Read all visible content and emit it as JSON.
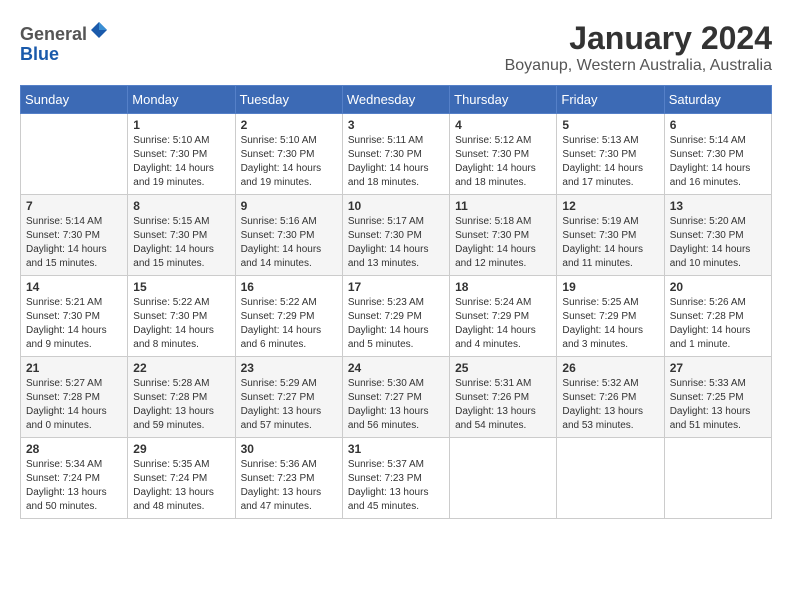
{
  "header": {
    "logo_line1": "General",
    "logo_line2": "Blue",
    "month_year": "January 2024",
    "location": "Boyanup, Western Australia, Australia"
  },
  "weekdays": [
    "Sunday",
    "Monday",
    "Tuesday",
    "Wednesday",
    "Thursday",
    "Friday",
    "Saturday"
  ],
  "weeks": [
    [
      {
        "num": "",
        "info": ""
      },
      {
        "num": "1",
        "info": "Sunrise: 5:10 AM\nSunset: 7:30 PM\nDaylight: 14 hours\nand 19 minutes."
      },
      {
        "num": "2",
        "info": "Sunrise: 5:10 AM\nSunset: 7:30 PM\nDaylight: 14 hours\nand 19 minutes."
      },
      {
        "num": "3",
        "info": "Sunrise: 5:11 AM\nSunset: 7:30 PM\nDaylight: 14 hours\nand 18 minutes."
      },
      {
        "num": "4",
        "info": "Sunrise: 5:12 AM\nSunset: 7:30 PM\nDaylight: 14 hours\nand 18 minutes."
      },
      {
        "num": "5",
        "info": "Sunrise: 5:13 AM\nSunset: 7:30 PM\nDaylight: 14 hours\nand 17 minutes."
      },
      {
        "num": "6",
        "info": "Sunrise: 5:14 AM\nSunset: 7:30 PM\nDaylight: 14 hours\nand 16 minutes."
      }
    ],
    [
      {
        "num": "7",
        "info": "Sunrise: 5:14 AM\nSunset: 7:30 PM\nDaylight: 14 hours\nand 15 minutes."
      },
      {
        "num": "8",
        "info": "Sunrise: 5:15 AM\nSunset: 7:30 PM\nDaylight: 14 hours\nand 15 minutes."
      },
      {
        "num": "9",
        "info": "Sunrise: 5:16 AM\nSunset: 7:30 PM\nDaylight: 14 hours\nand 14 minutes."
      },
      {
        "num": "10",
        "info": "Sunrise: 5:17 AM\nSunset: 7:30 PM\nDaylight: 14 hours\nand 13 minutes."
      },
      {
        "num": "11",
        "info": "Sunrise: 5:18 AM\nSunset: 7:30 PM\nDaylight: 14 hours\nand 12 minutes."
      },
      {
        "num": "12",
        "info": "Sunrise: 5:19 AM\nSunset: 7:30 PM\nDaylight: 14 hours\nand 11 minutes."
      },
      {
        "num": "13",
        "info": "Sunrise: 5:20 AM\nSunset: 7:30 PM\nDaylight: 14 hours\nand 10 minutes."
      }
    ],
    [
      {
        "num": "14",
        "info": "Sunrise: 5:21 AM\nSunset: 7:30 PM\nDaylight: 14 hours\nand 9 minutes."
      },
      {
        "num": "15",
        "info": "Sunrise: 5:22 AM\nSunset: 7:30 PM\nDaylight: 14 hours\nand 8 minutes."
      },
      {
        "num": "16",
        "info": "Sunrise: 5:22 AM\nSunset: 7:29 PM\nDaylight: 14 hours\nand 6 minutes."
      },
      {
        "num": "17",
        "info": "Sunrise: 5:23 AM\nSunset: 7:29 PM\nDaylight: 14 hours\nand 5 minutes."
      },
      {
        "num": "18",
        "info": "Sunrise: 5:24 AM\nSunset: 7:29 PM\nDaylight: 14 hours\nand 4 minutes."
      },
      {
        "num": "19",
        "info": "Sunrise: 5:25 AM\nSunset: 7:29 PM\nDaylight: 14 hours\nand 3 minutes."
      },
      {
        "num": "20",
        "info": "Sunrise: 5:26 AM\nSunset: 7:28 PM\nDaylight: 14 hours\nand 1 minute."
      }
    ],
    [
      {
        "num": "21",
        "info": "Sunrise: 5:27 AM\nSunset: 7:28 PM\nDaylight: 14 hours\nand 0 minutes."
      },
      {
        "num": "22",
        "info": "Sunrise: 5:28 AM\nSunset: 7:28 PM\nDaylight: 13 hours\nand 59 minutes."
      },
      {
        "num": "23",
        "info": "Sunrise: 5:29 AM\nSunset: 7:27 PM\nDaylight: 13 hours\nand 57 minutes."
      },
      {
        "num": "24",
        "info": "Sunrise: 5:30 AM\nSunset: 7:27 PM\nDaylight: 13 hours\nand 56 minutes."
      },
      {
        "num": "25",
        "info": "Sunrise: 5:31 AM\nSunset: 7:26 PM\nDaylight: 13 hours\nand 54 minutes."
      },
      {
        "num": "26",
        "info": "Sunrise: 5:32 AM\nSunset: 7:26 PM\nDaylight: 13 hours\nand 53 minutes."
      },
      {
        "num": "27",
        "info": "Sunrise: 5:33 AM\nSunset: 7:25 PM\nDaylight: 13 hours\nand 51 minutes."
      }
    ],
    [
      {
        "num": "28",
        "info": "Sunrise: 5:34 AM\nSunset: 7:24 PM\nDaylight: 13 hours\nand 50 minutes."
      },
      {
        "num": "29",
        "info": "Sunrise: 5:35 AM\nSunset: 7:24 PM\nDaylight: 13 hours\nand 48 minutes."
      },
      {
        "num": "30",
        "info": "Sunrise: 5:36 AM\nSunset: 7:23 PM\nDaylight: 13 hours\nand 47 minutes."
      },
      {
        "num": "31",
        "info": "Sunrise: 5:37 AM\nSunset: 7:23 PM\nDaylight: 13 hours\nand 45 minutes."
      },
      {
        "num": "",
        "info": ""
      },
      {
        "num": "",
        "info": ""
      },
      {
        "num": "",
        "info": ""
      }
    ]
  ]
}
